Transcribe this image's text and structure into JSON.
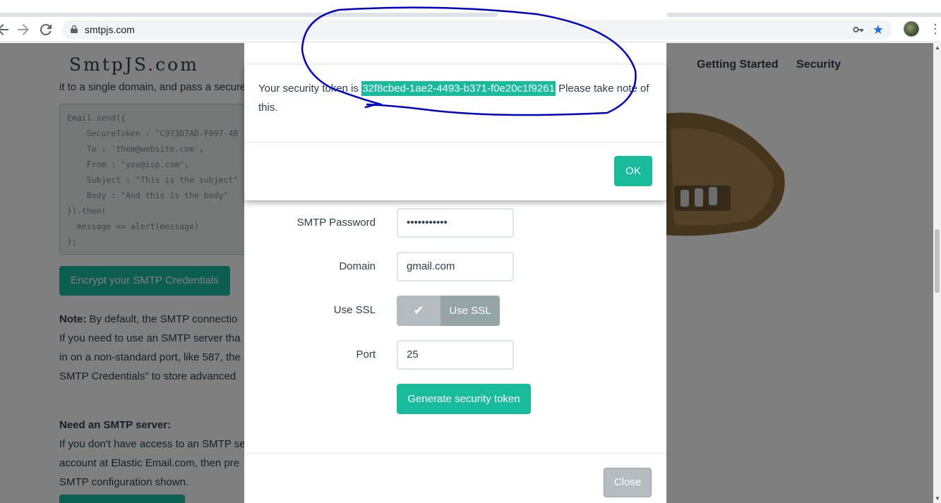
{
  "browser": {
    "url": "smtpjs.com"
  },
  "site": {
    "brand": "SmtpJS.com",
    "nav": [
      "Getting Started",
      "Security"
    ],
    "cut_text": "it to a single domain, and pass a secure token instead of credentials, example:",
    "code": "Email.send({\n    SecureToken : \"C973D7AD-F097-4B\n    To : 'them@website.com',\n    From : \"you@isp.com\",\n    Subject : \"This is the subject\"\n    Body : \"And this is the body\"\n}).then(\n  message => alert(message)\n);",
    "encrypt_button": "Encrypt your SMTP Credentials",
    "note_label": "Note:",
    "note_text": "By default, the SMTP connectio",
    "line2": "If you need to use an SMTP server tha",
    "line3": "in on a non-standard port, like 587, the",
    "line4": "SMTP Credentials\" to store advanced",
    "need_heading": "Need an SMTP server:",
    "need_line1": "If you don't have access to an SMTP se",
    "need_line2": "account at Elastic Email.com, then pre",
    "need_line3": "SMTP configuration shown."
  },
  "form": {
    "password_label": "SMTP Password",
    "password_value": "•••••••••••",
    "domain_label": "Domain",
    "domain_value": "gmail.com",
    "ssl_label": "Use SSL",
    "ssl_check": "✔",
    "ssl_text": "Use SSL",
    "port_label": "Port",
    "port_value": "25",
    "generate_button": "Generate security token",
    "close_button": "Close"
  },
  "alert": {
    "prefix": "Your security token is ",
    "token": "32f8cbed-1ae2-4493-b371-f0e20c1f9261",
    "suffix": " Please take note of this.",
    "ok_button": "OK"
  },
  "colors": {
    "accent": "#18bc9c",
    "annotation": "#0000cc"
  }
}
